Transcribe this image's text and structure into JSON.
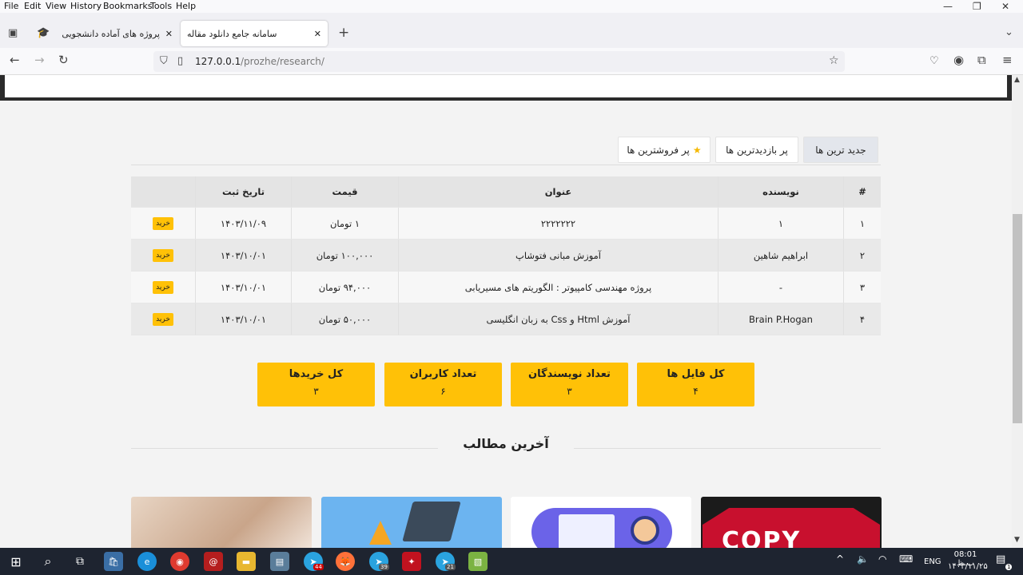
{
  "menubar": [
    "File",
    "Edit",
    "View",
    "History",
    "Bookmarks",
    "Tools",
    "Help"
  ],
  "tabs": [
    {
      "title": "پروژه های آماده دانشجویی"
    },
    {
      "title": "سامانه جامع دانلود مقاله"
    }
  ],
  "url": {
    "host": "127.0.0.1",
    "path": "/prozhe/research/"
  },
  "content_tabs": [
    "جدید ترین ها",
    "پر بازدیدترین ها",
    "پر فروشترین ها"
  ],
  "table": {
    "headers": [
      "#",
      "نویسنده",
      "عنوان",
      "قیمت",
      "تاریخ ثبت",
      ""
    ],
    "rows": [
      {
        "n": "۱",
        "author": "۱",
        "title": "۲۲۲۲۲۲۲",
        "price": "۱ تومان",
        "date": "۱۴۰۳/۱۱/۰۹",
        "buy": "خرید"
      },
      {
        "n": "۲",
        "author": "ابراهیم شاهین",
        "title": "آموزش مبانی فتوشاپ",
        "price": "۱۰۰,۰۰۰ تومان",
        "date": "۱۴۰۳/۱۰/۰۱",
        "buy": "خرید"
      },
      {
        "n": "۳",
        "author": "-",
        "title": "پروژه مهندسی کامپیوتر : الگوریتم های مسیریابی",
        "price": "۹۴,۰۰۰ تومان",
        "date": "۱۴۰۳/۱۰/۰۱",
        "buy": "خرید"
      },
      {
        "n": "۴",
        "author": "Brain P.Hogan",
        "title": "آموزش Html و Css به زبان انگلیسی",
        "price": "۵۰,۰۰۰ تومان",
        "date": "۱۴۰۳/۱۰/۰۱",
        "buy": "خرید"
      }
    ]
  },
  "stats": [
    {
      "label": "کل فایل ها",
      "value": "۴"
    },
    {
      "label": "تعداد نویسندگان",
      "value": "۳"
    },
    {
      "label": "تعداد کاربران",
      "value": "۶"
    },
    {
      "label": "کل خریدها",
      "value": "۳"
    }
  ],
  "latest_title": "آخرین مطالب",
  "card_text": "COPY",
  "taskbar": {
    "lang": "ENG",
    "time": "08:01 ب.ظ",
    "date": "۱۴۰۳/۱۱/۲۵",
    "badge1": "44",
    "badge2": "39",
    "badge3": "21",
    "badge4": "1"
  },
  "colors": {
    "accent": "#ffc107",
    "header": "#2b2b2b"
  }
}
